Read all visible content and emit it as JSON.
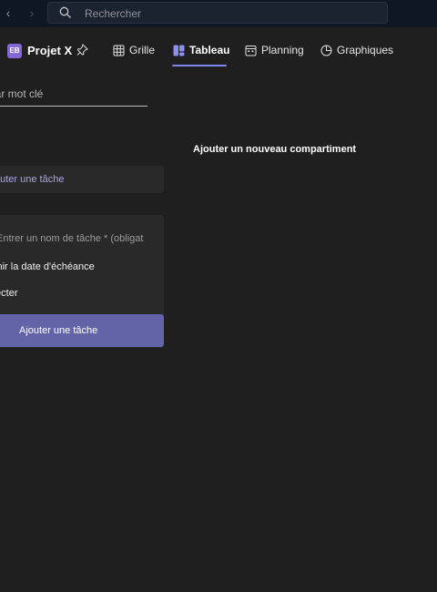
{
  "search": {
    "placeholder": "Rechercher"
  },
  "app": {
    "avatar_text": "EB",
    "title": "Projet X"
  },
  "tabs": [
    {
      "label": "Grille",
      "icon": "grid-icon"
    },
    {
      "label": "Tableau",
      "icon": "board-icon",
      "active": true
    },
    {
      "label": "Planning",
      "icon": "calendar-icon"
    },
    {
      "label": "Graphiques",
      "icon": "chart-icon"
    }
  ],
  "filter": {
    "placeholder": "par mot clé"
  },
  "board": {
    "add_bucket_label": "Ajouter un nouveau compartiment",
    "add_task_label": "outer une tâche",
    "task_name_placeholder": "Entrer un nom de tâche * (obligat",
    "due_date_label": "finir la date d'échéance",
    "assign_label": "fecter",
    "submit_label": "Ajouter une tâche"
  },
  "colors": {
    "accent": "#6264a7",
    "tab_underline": "#7f85f5",
    "avatar": "#8469d6"
  }
}
